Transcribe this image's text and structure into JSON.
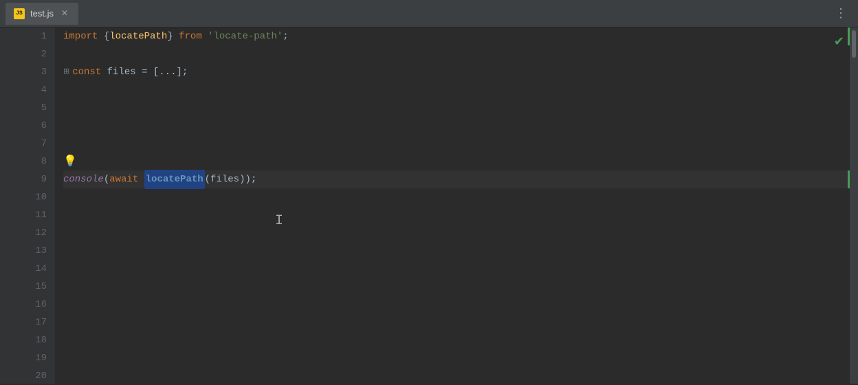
{
  "tab": {
    "icon_label": "JS",
    "file_name": "test.js",
    "close_symbol": "✕"
  },
  "more_icon": "⋮",
  "check_icon": "✔",
  "lightbulb": "💡",
  "lines": [
    {
      "number": "1",
      "content": "line1",
      "highlighted": false
    },
    {
      "number": "2",
      "content": "line2",
      "highlighted": false
    },
    {
      "number": "3",
      "content": "line3",
      "highlighted": false
    },
    {
      "number": "8",
      "content": "line8",
      "highlighted": false
    },
    {
      "number": "9",
      "content": "line9",
      "highlighted": true
    }
  ],
  "code": {
    "line1_import": "import ",
    "line1_brace_open": "{",
    "line1_locatepath": "locatePath",
    "line1_brace_close": "}",
    "line1_from": " from ",
    "line1_string": "'locate-path'",
    "line1_semi": ";",
    "line3_const": "const ",
    "line3_files": "files",
    "line3_assign": " = ",
    "line3_array": "[...]",
    "line3_semi": ";",
    "line9_console": "console",
    "line9_paren1": "(",
    "line9_await": "await ",
    "line9_locatepath": "locatePath",
    "line9_args": "(files)",
    "line9_close": ");",
    "cursor_char": "I"
  },
  "colors": {
    "bg": "#2b2b2b",
    "tab_bg": "#4e5254",
    "gutter_bg": "#313335",
    "highlight_line": "#323232",
    "accent_green": "#499c54"
  }
}
